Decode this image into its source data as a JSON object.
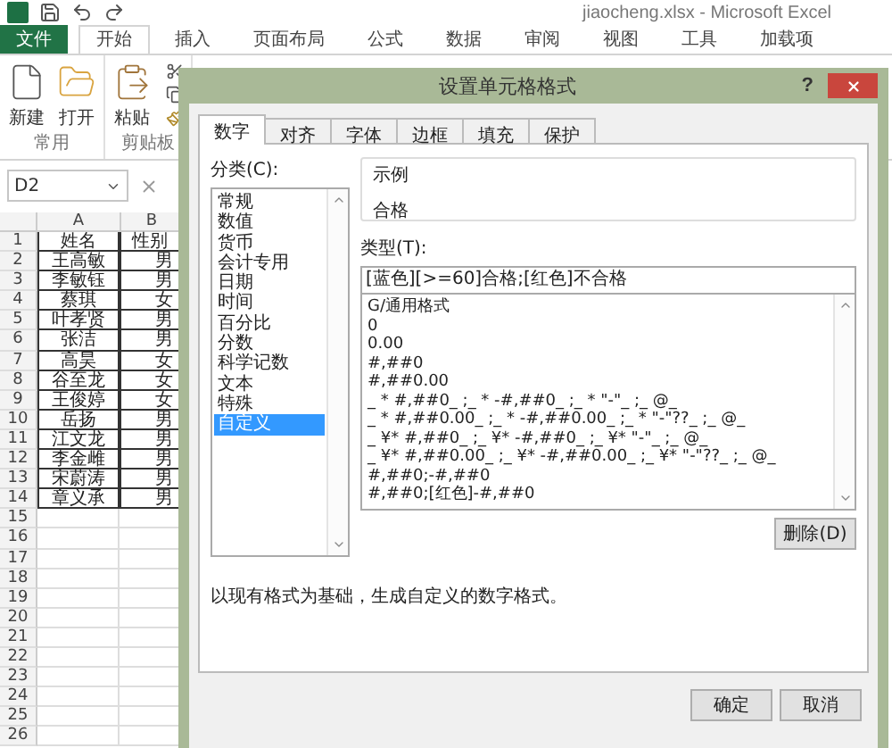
{
  "app": {
    "title": "jiaocheng.xlsx - Microsoft Excel"
  },
  "ribbon_tabs": [
    {
      "label": "文件",
      "kind": "file",
      "selected": false
    },
    {
      "label": "开始",
      "kind": "tab",
      "selected": true
    },
    {
      "label": "插入",
      "kind": "tab",
      "selected": false
    },
    {
      "label": "页面布局",
      "kind": "tab",
      "selected": false
    },
    {
      "label": "公式",
      "kind": "tab",
      "selected": false
    },
    {
      "label": "数据",
      "kind": "tab",
      "selected": false
    },
    {
      "label": "审阅",
      "kind": "tab",
      "selected": false
    },
    {
      "label": "视图",
      "kind": "tab",
      "selected": false
    },
    {
      "label": "工具",
      "kind": "tab",
      "selected": false
    },
    {
      "label": "加载项",
      "kind": "tab",
      "selected": false
    }
  ],
  "ribbon_groups": [
    {
      "label": "常用",
      "buttons": [
        {
          "label": "新建",
          "kind": "new"
        },
        {
          "label": "打开",
          "kind": "open"
        }
      ]
    },
    {
      "label": "剪贴板",
      "buttons": [
        {
          "label": "粘贴",
          "kind": "paste"
        }
      ]
    }
  ],
  "name_box": "D2",
  "columns": [
    "A",
    "B"
  ],
  "rows": [
    {
      "number": "1",
      "cells": [
        "姓名",
        "性别"
      ]
    },
    {
      "number": "2",
      "cells": [
        "王高敏",
        "男"
      ]
    },
    {
      "number": "3",
      "cells": [
        "李敏钰",
        "男"
      ]
    },
    {
      "number": "4",
      "cells": [
        "蔡琪",
        "女"
      ]
    },
    {
      "number": "5",
      "cells": [
        "叶孝贤",
        "男"
      ]
    },
    {
      "number": "6",
      "cells": [
        "张洁",
        "男"
      ]
    },
    {
      "number": "7",
      "cells": [
        "高昊",
        "女"
      ]
    },
    {
      "number": "8",
      "cells": [
        "谷至龙",
        "女"
      ]
    },
    {
      "number": "9",
      "cells": [
        "王俊婷",
        "女"
      ]
    },
    {
      "number": "10",
      "cells": [
        "岳扬",
        "男"
      ]
    },
    {
      "number": "11",
      "cells": [
        "江文龙",
        "男"
      ]
    },
    {
      "number": "12",
      "cells": [
        "李金雌",
        "男"
      ]
    },
    {
      "number": "13",
      "cells": [
        "宋蔚涛",
        "男"
      ]
    },
    {
      "number": "14",
      "cells": [
        "章义承",
        "男"
      ]
    },
    {
      "number": "15"
    },
    {
      "number": "16"
    },
    {
      "number": "17"
    },
    {
      "number": "18"
    },
    {
      "number": "19"
    },
    {
      "number": "20"
    },
    {
      "number": "21"
    },
    {
      "number": "22"
    },
    {
      "number": "23"
    },
    {
      "number": "24"
    },
    {
      "number": "25"
    },
    {
      "number": "26"
    }
  ],
  "dialog": {
    "title": "设置单元格格式",
    "help": "?",
    "tabs": [
      {
        "label": "数字",
        "selected": true
      },
      {
        "label": "对齐",
        "selected": false
      },
      {
        "label": "字体",
        "selected": false
      },
      {
        "label": "边框",
        "selected": false
      },
      {
        "label": "填充",
        "selected": false
      },
      {
        "label": "保护",
        "selected": false
      }
    ],
    "category_label": "分类(C):",
    "categories": [
      {
        "label": "常规",
        "selected": false
      },
      {
        "label": "数值",
        "selected": false
      },
      {
        "label": "货币",
        "selected": false
      },
      {
        "label": "会计专用",
        "selected": false
      },
      {
        "label": "日期",
        "selected": false
      },
      {
        "label": "时间",
        "selected": false
      },
      {
        "label": "百分比",
        "selected": false
      },
      {
        "label": "分数",
        "selected": false
      },
      {
        "label": "科学记数",
        "selected": false
      },
      {
        "label": "文本",
        "selected": false
      },
      {
        "label": "特殊",
        "selected": false
      },
      {
        "label": "自定义",
        "selected": true
      }
    ],
    "sample_label": "示例",
    "sample": "合格",
    "type_label": "类型(T):",
    "type_value": "[蓝色][>=60]合格;[红色]不合格",
    "formats": [
      "G/通用格式",
      "0",
      "0.00",
      "#,##0",
      "#,##0.00",
      "_ * #,##0_ ;_ * -#,##0_ ;_ * \"-\"_ ;_ @_",
      "_ * #,##0.00_ ;_ * -#,##0.00_ ;_ * \"-\"??_ ;_ @_",
      "_ ¥* #,##0_ ;_ ¥* -#,##0_ ;_ ¥* \"-\"_ ;_ @_",
      "_ ¥* #,##0.00_ ;_ ¥* -#,##0.00_ ;_ ¥* \"-\"??_ ;_ @_",
      "#,##0;-#,##0",
      "#,##0;[红色]-#,##0"
    ],
    "delete_button": "删除(D)",
    "description": "以现有格式为基础，生成自定义的数字格式。",
    "buttons": [
      "确定",
      "取消"
    ]
  }
}
